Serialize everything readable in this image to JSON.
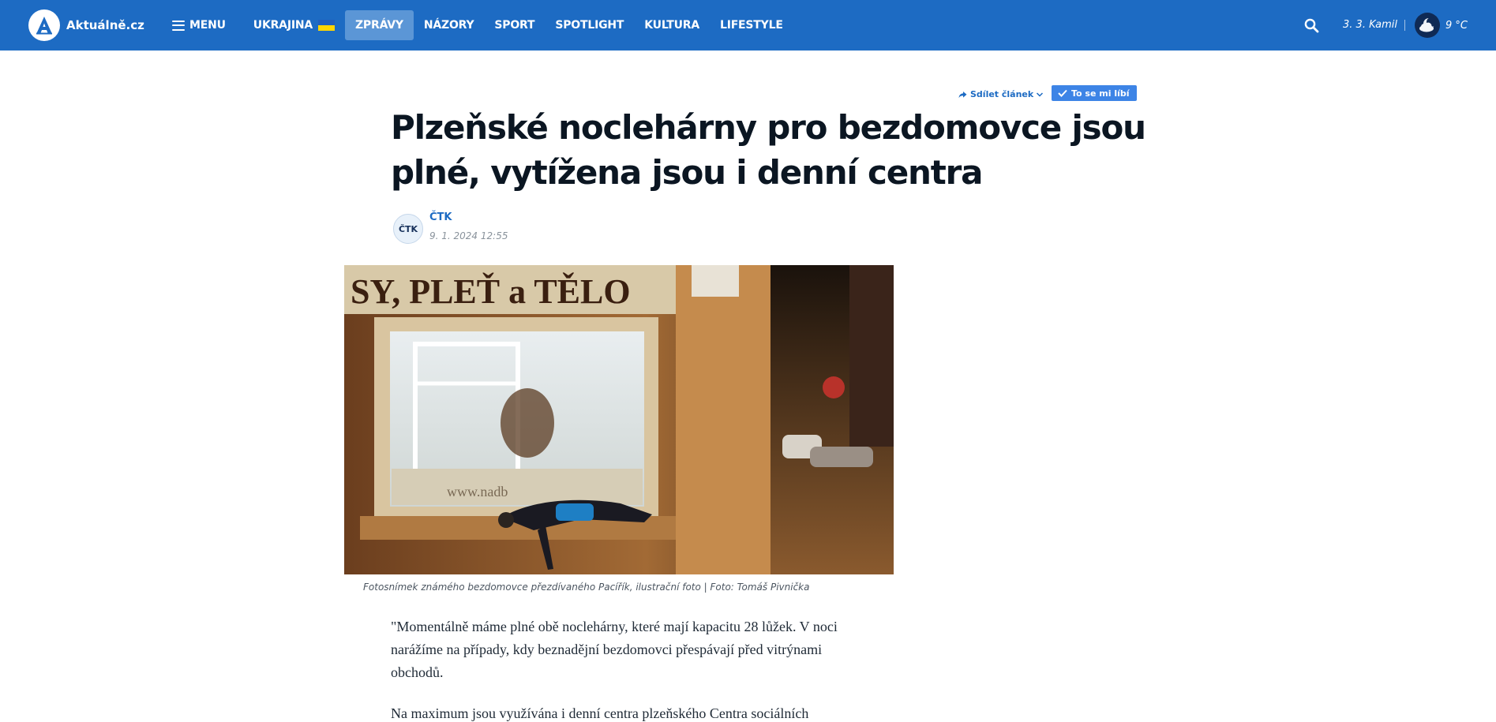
{
  "header": {
    "logo_text": "Aktuálně.cz",
    "menu_label": "MENU",
    "nav": [
      {
        "label": "UKRAJINA"
      },
      {
        "label": "ZPRÁVY"
      },
      {
        "label": "NÁZORY"
      },
      {
        "label": "SPORT"
      },
      {
        "label": "SPOTLIGHT"
      },
      {
        "label": "KULTURA"
      },
      {
        "label": "LIFESTYLE"
      }
    ],
    "active_nav": "ZPRÁVY",
    "nameday": "3. 3. Kamil",
    "temperature": "9 °C",
    "icons": [
      "menu-icon",
      "ukraine-flag-icon",
      "search-icon",
      "weather-moon-cloud-icon"
    ],
    "colors": {
      "bar": "#1d6bc3",
      "active_tab": "#5b96d6"
    }
  },
  "article": {
    "share_label": "Sdílet článek",
    "like_label": "To se mi líbí",
    "title": "Plzeňské noclehárny pro bezdomovce jsou plné, vytížena jsou i denní centra",
    "author": "ČTK",
    "author_logo_text": "ČTK",
    "date": "9. 1. 2024 12:55",
    "photo_caption": "Fotosnímek známého bezdomovce přezdívaného Pacířík, ilustrační foto | Foto: Tomáš Pivnička",
    "photo_sign_text": "SY, PLEŤ a TĚLO",
    "photo_window_text": "www.nadb",
    "paragraphs": [
      "\"Momentálně máme plné obě noclehárny, které mají kapacitu 28 lůžek. V noci narážíme na případy, kdy beznadějní bezdomovci přespávají před vitrýnami obchodů.",
      "Na maximum jsou využívána i denní centra plzeňského Centra sociálních"
    ]
  }
}
